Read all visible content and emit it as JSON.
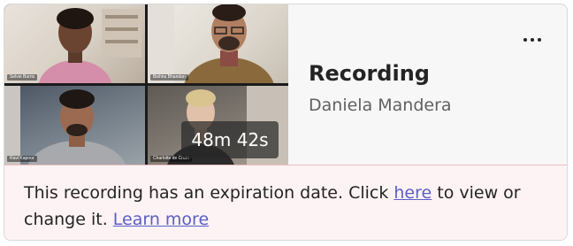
{
  "card": {
    "title": "Recording",
    "owner": "Daniela Mandera",
    "duration": "48m 42s",
    "more_options_icon": "more-horizontal-icon"
  },
  "participants": [
    {
      "name": "Selvie Burris"
    },
    {
      "name": "Bishnu Bhandari"
    },
    {
      "name": "Ravi Kapoor"
    },
    {
      "name": "Charlotte de Crum"
    }
  ],
  "banner": {
    "text_before": "This recording has an expiration date. Click ",
    "here_link": "here",
    "text_middle": " to view or change it. ",
    "learn_more_link": "Learn more"
  },
  "colors": {
    "link": "#5b5fc7",
    "banner_background": "#fdf3f4",
    "banner_border": "#f1bbbc",
    "card_background": "#f7f7f7"
  }
}
